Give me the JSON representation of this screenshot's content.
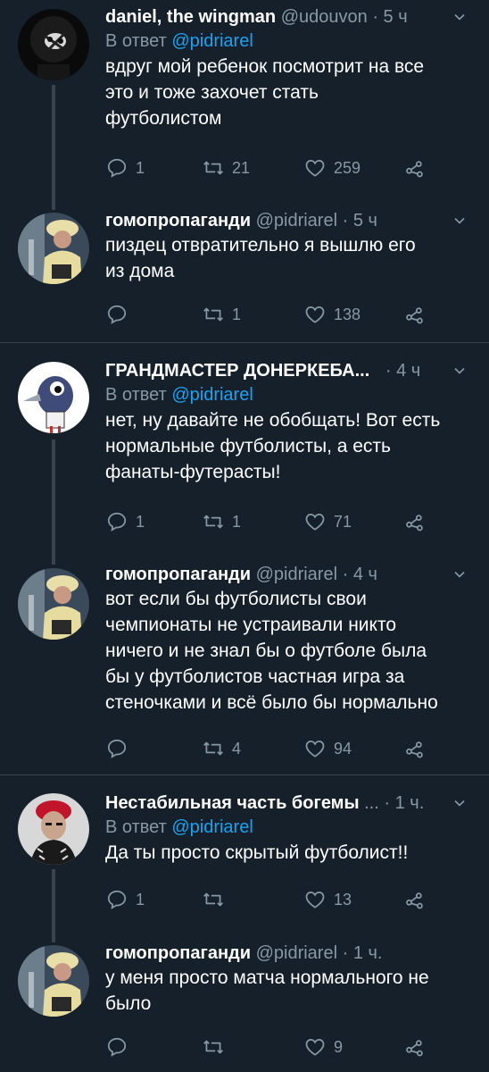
{
  "tweets": [
    {
      "name": "daniel, the wingman",
      "handle": "@udouvon",
      "time": "5 ч",
      "reply_prefix": "В ответ",
      "reply_to": "@pidriarel",
      "text_lines": [
        "вдруг мой ребенок посмотрит на все",
        "это и тоже захочет стать",
        "футболистом"
      ],
      "replies": "1",
      "retweets": "21",
      "likes": "259",
      "avatar": "dark-face-avatar"
    },
    {
      "name": "гомопропаганди",
      "handle": "@pidriarel",
      "time": "5 ч",
      "text_lines": [
        "пиздец отвратительно я вышлю его",
        "из дома"
      ],
      "replies": "",
      "retweets": "1",
      "likes": "138",
      "avatar": "costume-avatar"
    },
    {
      "name": "ГРАНДМАСТЕР ДОНЕРКЕБА...",
      "handle": "",
      "time": "4 ч",
      "reply_prefix": "В ответ",
      "reply_to": "@pidriarel",
      "text_lines": [
        "нет, ну давайте не обобщать! Вот есть",
        "нормальные футболисты, а есть",
        "фанаты-футерасты!"
      ],
      "replies": "1",
      "retweets": "1",
      "likes": "71",
      "avatar": "bird-avatar"
    },
    {
      "name": "гомопропаганди",
      "handle": "@pidriarel",
      "time": "4 ч",
      "text_lines": [
        "вот если бы футболисты свои",
        "чемпионаты не устраивали никто",
        "ничего и не знал бы о футболе была",
        "бы у футболистов частная игра за",
        "стеночками и всё было бы нормально"
      ],
      "replies": "",
      "retweets": "4",
      "likes": "94",
      "avatar": "costume-avatar"
    },
    {
      "name": "Нестабильная часть богемы",
      "handle": "...",
      "time": "1 ч.",
      "reply_prefix": "В ответ",
      "reply_to": "@pidriarel",
      "text_lines": [
        "Да ты просто скрытый футболист!!"
      ],
      "replies": "1",
      "retweets": "",
      "likes": "13",
      "avatar": "red-hair-avatar"
    },
    {
      "name": "гомопропаганди",
      "handle": "@pidriarel",
      "time": "1 ч.",
      "text_lines": [
        "у меня просто матча нормального не",
        "было"
      ],
      "replies": "",
      "retweets": "",
      "likes": "9",
      "avatar": "costume-avatar"
    }
  ],
  "colors": {
    "background": "#15202b",
    "muted": "#8899a6",
    "link": "#1da1f2",
    "line": "#38444d"
  }
}
